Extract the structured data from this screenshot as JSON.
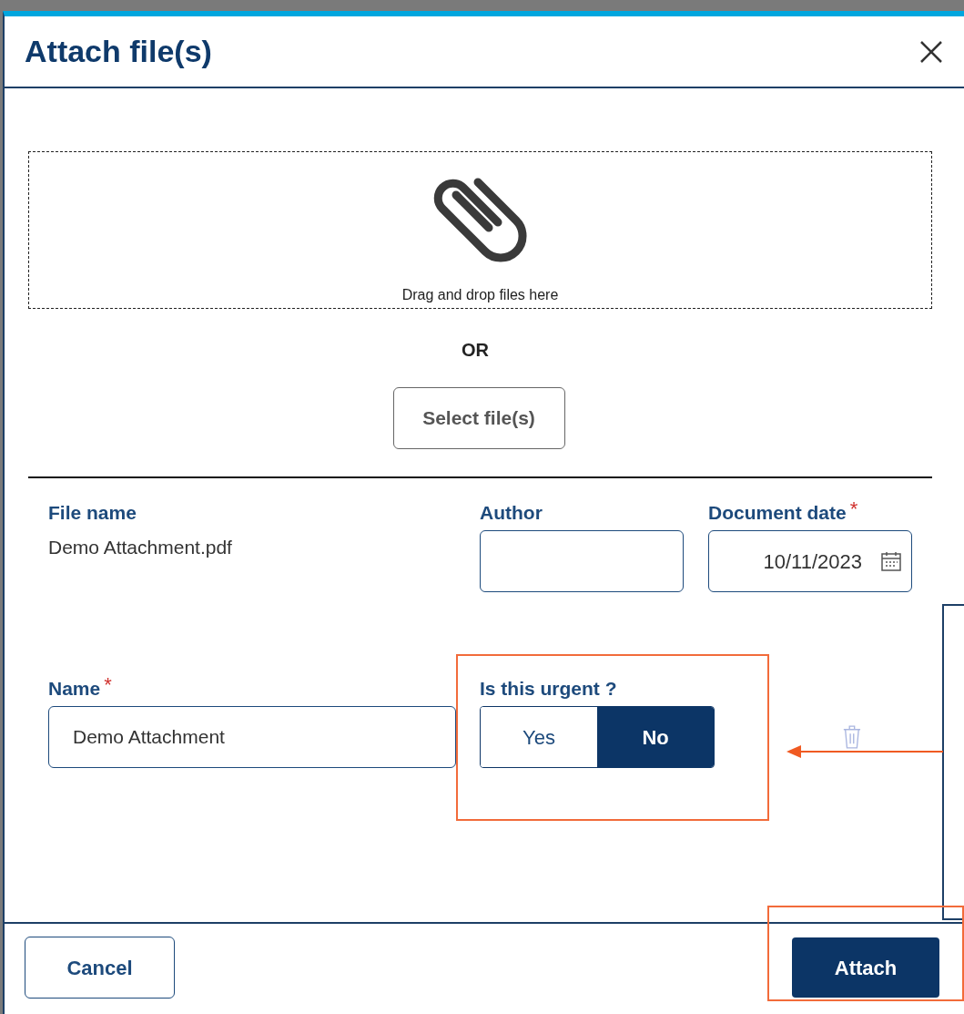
{
  "dialog": {
    "title": "Attach file(s)"
  },
  "dropzone": {
    "hint": "Drag and drop files here"
  },
  "separator_text": "OR",
  "select_button": "Select file(s)",
  "file_name": {
    "label": "File name",
    "value": "Demo Attachment.pdf"
  },
  "author": {
    "label": "Author"
  },
  "document_date": {
    "label": "Document date",
    "required_mark": "*",
    "value": "10/11/2023"
  },
  "name": {
    "label": "Name",
    "required_mark": "*",
    "value": "Demo Attachment"
  },
  "urgent": {
    "label": "Is this urgent ?",
    "options": [
      {
        "label": "Yes",
        "selected": false
      },
      {
        "label": "No",
        "selected": true
      }
    ]
  },
  "footer": {
    "buttons": [
      {
        "label": "Cancel",
        "kind": "secondary"
      },
      {
        "label": "Attach",
        "kind": "primary"
      }
    ]
  }
}
